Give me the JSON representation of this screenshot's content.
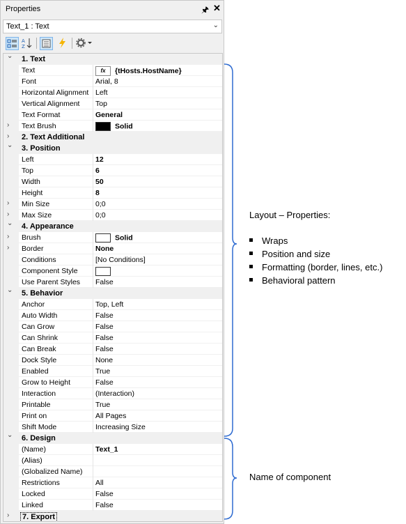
{
  "panel": {
    "title": "Properties",
    "pin_glyph": "🖈",
    "close_glyph": "✕",
    "selector": {
      "value": "Text_1 : Text",
      "dropdown_glyph": "⌄"
    }
  },
  "toolbar": {
    "icons": [
      "categorized-icon",
      "alphabetical-icon",
      "properties-icon",
      "events-icon",
      "settings-icon"
    ]
  },
  "grid": {
    "rows": [
      {
        "kind": "cat",
        "expanded": true,
        "name": "1. Text"
      },
      {
        "kind": "prop",
        "name": "Text",
        "value": "{tHosts.HostName}",
        "bold": true,
        "icon": "fx"
      },
      {
        "kind": "prop",
        "name": "Font",
        "value": "Arial, 8"
      },
      {
        "kind": "prop",
        "name": "Horizontal Alignment",
        "value": "Left"
      },
      {
        "kind": "prop",
        "name": "Vertical Alignment",
        "value": "Top"
      },
      {
        "kind": "prop",
        "name": "Text Format",
        "value": "General",
        "bold": true
      },
      {
        "kind": "prop",
        "name": "Text Brush",
        "value": "Solid",
        "bold": true,
        "swatch": "black",
        "collapsed": true
      },
      {
        "kind": "cat",
        "expanded": false,
        "name": "2. Text  Additional"
      },
      {
        "kind": "cat",
        "expanded": true,
        "name": "3. Position"
      },
      {
        "kind": "prop",
        "name": "Left",
        "value": "12",
        "bold": true
      },
      {
        "kind": "prop",
        "name": "Top",
        "value": "6",
        "bold": true
      },
      {
        "kind": "prop",
        "name": "Width",
        "value": "50",
        "bold": true
      },
      {
        "kind": "prop",
        "name": "Height",
        "value": "8",
        "bold": true
      },
      {
        "kind": "prop",
        "name": "Min Size",
        "value": "0;0",
        "collapsed": true
      },
      {
        "kind": "prop",
        "name": "Max Size",
        "value": "0;0",
        "collapsed": true
      },
      {
        "kind": "cat",
        "expanded": true,
        "name": "4. Appearance"
      },
      {
        "kind": "prop",
        "name": "Brush",
        "value": "Solid",
        "bold": true,
        "swatch": "white",
        "collapsed": true
      },
      {
        "kind": "prop",
        "name": "Border",
        "value": "None",
        "bold": true,
        "collapsed": true
      },
      {
        "kind": "prop",
        "name": "Conditions",
        "value": "[No Conditions]"
      },
      {
        "kind": "prop",
        "name": "Component Style",
        "value": "",
        "swatch": "white"
      },
      {
        "kind": "prop",
        "name": "Use Parent Styles",
        "value": "False"
      },
      {
        "kind": "cat",
        "expanded": true,
        "name": "5. Behavior"
      },
      {
        "kind": "prop",
        "name": "Anchor",
        "value": "Top, Left"
      },
      {
        "kind": "prop",
        "name": "Auto Width",
        "value": "False"
      },
      {
        "kind": "prop",
        "name": "Can Grow",
        "value": "False"
      },
      {
        "kind": "prop",
        "name": "Can Shrink",
        "value": "False"
      },
      {
        "kind": "prop",
        "name": "Can Break",
        "value": "False"
      },
      {
        "kind": "prop",
        "name": "Dock Style",
        "value": "None"
      },
      {
        "kind": "prop",
        "name": "Enabled",
        "value": "True"
      },
      {
        "kind": "prop",
        "name": "Grow to Height",
        "value": "False"
      },
      {
        "kind": "prop",
        "name": "Interaction",
        "value": "(Interaction)"
      },
      {
        "kind": "prop",
        "name": "Printable",
        "value": "True"
      },
      {
        "kind": "prop",
        "name": "Print on",
        "value": "All Pages"
      },
      {
        "kind": "prop",
        "name": "Shift Mode",
        "value": "Increasing Size"
      },
      {
        "kind": "cat",
        "expanded": true,
        "name": "6. Design"
      },
      {
        "kind": "prop",
        "name": "(Name)",
        "value": "Text_1",
        "bold": true
      },
      {
        "kind": "prop",
        "name": "(Alias)",
        "value": ""
      },
      {
        "kind": "prop",
        "name": "(Globalized Name)",
        "value": ""
      },
      {
        "kind": "prop",
        "name": "Restrictions",
        "value": "All"
      },
      {
        "kind": "prop",
        "name": "Locked",
        "value": "False"
      },
      {
        "kind": "prop",
        "name": "Linked",
        "value": "False"
      },
      {
        "kind": "cat",
        "expanded": false,
        "name": "7. Export",
        "focused": true
      }
    ]
  },
  "annotations": {
    "layout_title": "Layout – Properties:",
    "bullets": [
      "Wraps",
      "Position and size",
      "Formatting (border, lines, etc.)",
      "Behavioral pattern"
    ],
    "name_label": "Name of component",
    "brace_color": "#2e6bd1"
  }
}
